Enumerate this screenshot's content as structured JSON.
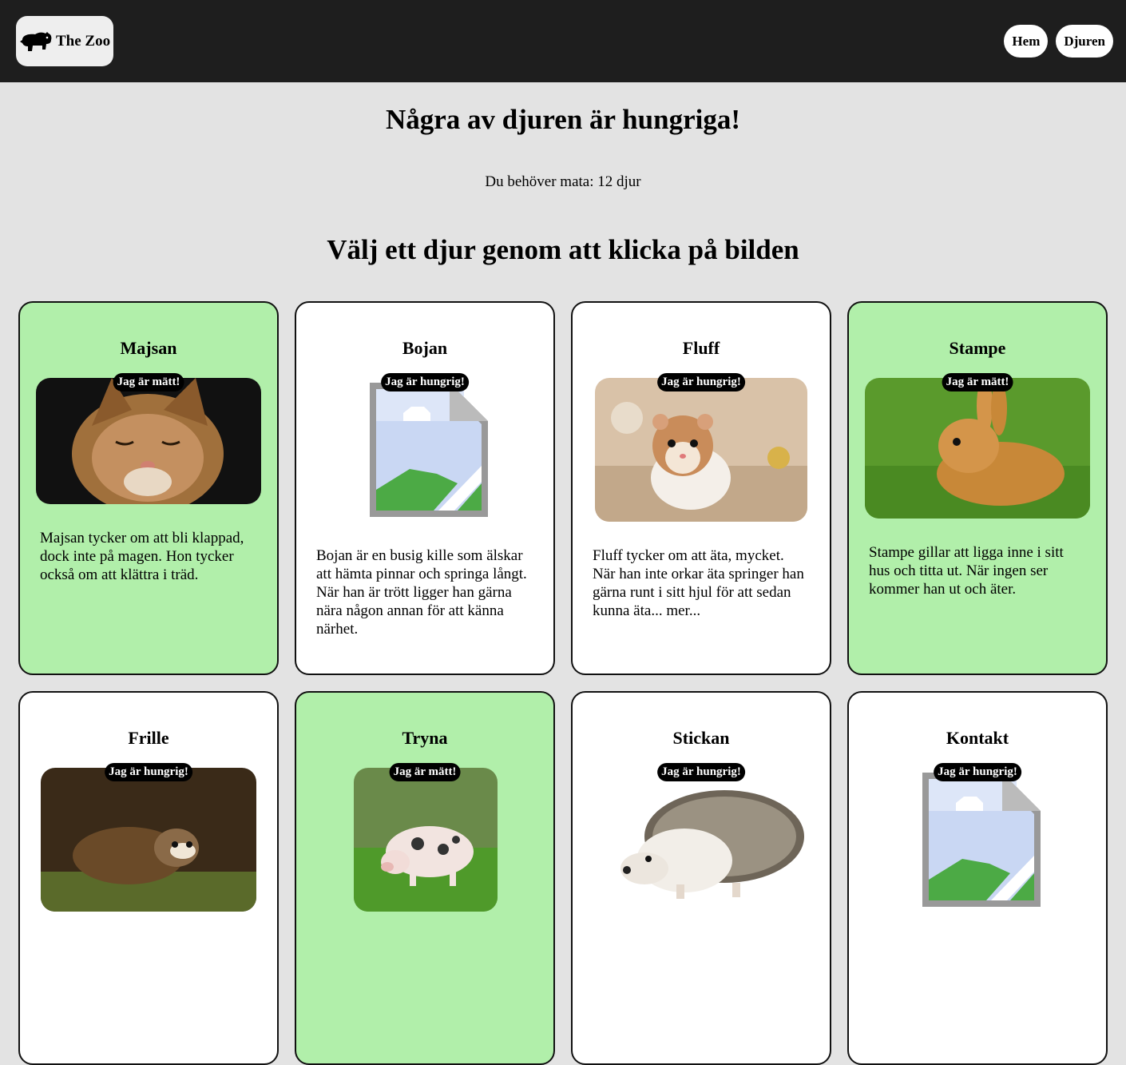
{
  "header": {
    "logo_text": "The Zoo",
    "nav": [
      {
        "label": "Hem"
      },
      {
        "label": "Djuren"
      }
    ]
  },
  "main": {
    "headline": "Några av djuren är hungriga!",
    "feed_count_text": "Du behöver mata: 12 djur",
    "subhead": "Välj ett djur genom att klicka på bilden"
  },
  "animals": [
    {
      "name": "Majsan",
      "status": "Jag är mätt!",
      "fed": true,
      "image": "cat-photo",
      "description": "Majsan tycker om att bli klappad, dock inte på magen. Hon tycker också om att klättra i träd."
    },
    {
      "name": "Bojan",
      "status": "Jag är hungrig!",
      "fed": false,
      "image": "broken-image-icon",
      "description": "Bojan är en busig kille som älskar att hämta pinnar och springa långt. När han är trött ligger han gärna nära någon annan för att känna närhet."
    },
    {
      "name": "Fluff",
      "status": "Jag är hungrig!",
      "fed": false,
      "image": "hamster-photo",
      "description": "Fluff tycker om att äta, mycket. När han inte orkar äta springer han gärna runt i sitt hjul för att sedan kunna äta... mer..."
    },
    {
      "name": "Stampe",
      "status": "Jag är mätt!",
      "fed": true,
      "image": "rabbit-photo",
      "description": "Stampe gillar att ligga inne i sitt hus och titta ut. När ingen ser kommer han ut och äter."
    },
    {
      "name": "Frille",
      "status": "Jag är hungrig!",
      "fed": false,
      "image": "ferret-photo",
      "description": ""
    },
    {
      "name": "Tryna",
      "status": "Jag är mätt!",
      "fed": true,
      "image": "pig-photo",
      "description": ""
    },
    {
      "name": "Stickan",
      "status": "Jag är hungrig!",
      "fed": false,
      "image": "hedgehog-photo",
      "description": ""
    },
    {
      "name": "Kontakt",
      "status": "Jag är hungrig!",
      "fed": false,
      "image": "broken-image-icon",
      "description": ""
    }
  ]
}
